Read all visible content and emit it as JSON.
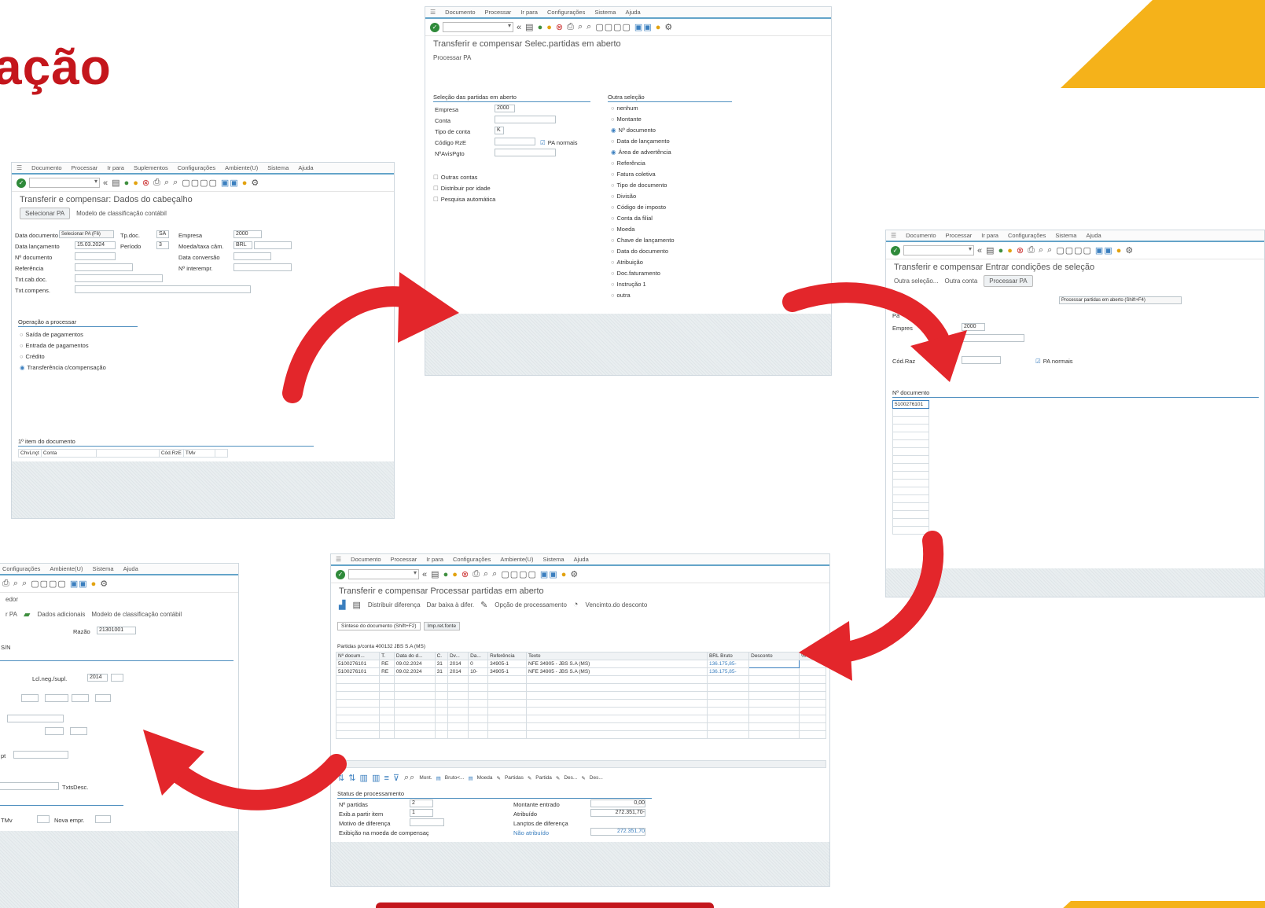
{
  "title": "ação",
  "menu_common": {
    "documento": "Documento",
    "processar": "Processar",
    "ir_para": "Ir para",
    "suplementos": "Suplementos",
    "configuracoes": "Configurações",
    "ambiente": "Ambiente(U)",
    "sistema": "Sistema",
    "ajuda": "Ajuda"
  },
  "win1": {
    "title": "Transferir e compensar: Dados do cabeçalho",
    "btn_sel_pa": "Selecionar PA",
    "btn_modelo": "Modelo de classificação contábil",
    "tooltip": "Selecionar PA  (F6)",
    "lbl_data_doc": "Data documento",
    "lbl_tp_doc": "Tp.doc.",
    "val_tp_doc": "SA",
    "lbl_empresa": "Empresa",
    "val_empresa": "2000",
    "lbl_data_lanc": "Data lançamento",
    "val_data_lanc": "15.03.2024",
    "lbl_periodo": "Período",
    "val_periodo": "3",
    "lbl_moeda": "Moeda/taxa câm.",
    "val_moeda": "BRL",
    "lbl_nr_doc": "Nº documento",
    "lbl_data_conv": "Data conversão",
    "lbl_ref": "Referência",
    "lbl_nr_interempr": "Nº interempr.",
    "lbl_txt_cab": "Txt.cab.doc.",
    "lbl_txt_comp": "Txt.compens.",
    "grp_operacao": "Operação a processar",
    "op1": "Saída de pagamentos",
    "op2": "Entrada de pagamentos",
    "op3": "Crédito",
    "op4": "Transferência c/compensação",
    "grp_item": "1º item do documento",
    "col_chvlnct": "ChvLnçt",
    "col_conta": "Conta",
    "col_codrze": "Cód.RzE",
    "col_tmv": "TMv"
  },
  "win2": {
    "title": "Transferir e compensar Selec.partidas em aberto",
    "btn_processar": "Processar PA",
    "grp_sel": "Seleção das partidas em aberto",
    "lbl_empresa": "Empresa",
    "val_empresa": "2000",
    "lbl_conta": "Conta",
    "lbl_tipo_conta": "Tipo de conta",
    "val_tipo_conta": "K",
    "lbl_cod_rze": "Código RzE",
    "chk_pa_normais": "PA normais",
    "lbl_nfav": "NºAvisPgto",
    "chk_outras": "Outras contas",
    "chk_distribuir": "Distribuir por idade",
    "chk_pesquisa": "Pesquisa automática",
    "grp_outra": "Outra seleção",
    "opts": [
      "nenhum",
      "Montante",
      "Nº documento",
      "Data de lançamento",
      "Área de advertência",
      "Referência",
      "Fatura coletiva",
      "Tipo de documento",
      "Divisão",
      "Código de imposto",
      "Conta da filial",
      "Moeda",
      "Chave de lançamento",
      "Data do documento",
      "Atribuição",
      "Doc.faturamento",
      "Instrução 1",
      "outra"
    ]
  },
  "win3": {
    "title": "Transferir e compensar Entrar condições de seleção",
    "btn_outra_sel": "Outra seleção...",
    "btn_outra_conta": "Outra conta",
    "btn_processar": "Processar PA",
    "tooltip": "Processar partidas em aberto  (Shift+F4)",
    "lbl_pa": "Pa",
    "lbl_empresa": "Empres",
    "val_empresa": "2000",
    "lbl_cod": "Cód.Raz",
    "chk_pa_normais": "PA normais",
    "grp_nr_doc": "Nº documento",
    "val_nr_doc": "5100276101"
  },
  "win4": {
    "title": "Transferir e compensar Processar partidas em aberto",
    "btn_distribuir": "Distribuir diferença",
    "btn_dar_baixa": "Dar baixa à difer.",
    "btn_opcao": "Opção de processamento",
    "btn_vencimento": "Vencimto.do desconto",
    "tab1": "Síntese do documento  (Shift+F2)",
    "tab2": "Imp.ret.fonte",
    "subtitle": "Partidas p/conta 400132 JBS S.A (MS)",
    "cols": [
      "Nº docum...",
      "T.",
      "Data do d...",
      "C.",
      "Dv...",
      "Da...",
      "Referência",
      "Texto",
      "BRL Bruto",
      "Desconto",
      "% de..."
    ],
    "rows": [
      [
        "5100276101",
        "RE",
        "09.02.2024",
        "31",
        "2014",
        "0",
        "34905-1",
        "NFE 34905 - JBS S.A (MS)",
        "136.175,85-",
        "",
        ""
      ],
      [
        "5100276101",
        "RE",
        "09.02.2024",
        "31",
        "2014",
        "10-",
        "34905-1",
        "NFE 34905 - JBS S.A (MS)",
        "136.175,85-",
        "",
        ""
      ]
    ],
    "tb_mont": "Mont.",
    "tb_bruto": "Bruto<...",
    "tb_moeda": "Moeda",
    "tb_partidas": "Partidas",
    "tb_partida": "Partida",
    "tb_des1": "Des...",
    "tb_des2": "Des...",
    "grp_status": "Status de processamento",
    "lbl_nr_partidas": "Nº partidas",
    "val_nr_partidas": "2",
    "lbl_exib": "Exib.a partir item",
    "val_exib": "1",
    "lbl_motivo": "Motivo de diferença",
    "lbl_exibicao": "Exibição na moeda de compensaç",
    "lbl_montante": "Montante entrado",
    "val_montante": "0,00",
    "lbl_atribuido": "Atribuído",
    "val_atribuido": "272.351,70-",
    "lbl_lanctos": "Lançtos.de diferença",
    "lbl_nao_atrib": "Não atribuído",
    "val_nao_atrib": "272.351,70"
  },
  "win5": {
    "menu_conf": "Configurações",
    "menu_amb": "Ambiente(U)",
    "menu_sis": "Sistema",
    "menu_aj": "Ajuda",
    "frag_dor": "edor",
    "frag_pa": "r PA",
    "btn_dados": "Dados adicionais",
    "btn_modelo": "Modelo de classificação contábil",
    "lbl_razao": "Razão",
    "val_razao": "21301001",
    "frag_sn": "S/N",
    "lbl_lcl": "Lcl.neg./supl.",
    "val_lcl": "2014",
    "frag_txtsdesc": "TxtsDesc.",
    "frag_tmv": "TMv",
    "lbl_nova": "Nova empr.",
    "frag_pt": "pt"
  }
}
